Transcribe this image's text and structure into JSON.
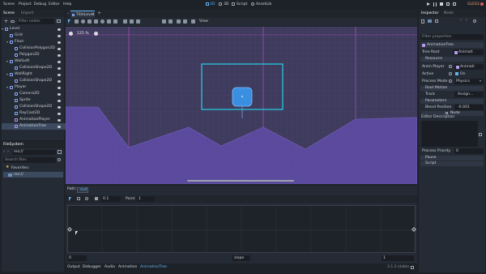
{
  "menu": [
    "Scene",
    "Project",
    "Debug",
    "Editor",
    "Help"
  ],
  "workspaces": [
    "2D",
    "3D",
    "Script",
    "AssetLib"
  ],
  "renderer": "GLES3",
  "left_tabs": [
    "Scene",
    "Import"
  ],
  "filter_nodes_placeholder": "Filter nodes",
  "scene_tree": [
    {
      "label": "Level",
      "depth": 0,
      "icon": "node2d-icon",
      "color": "#8fb0ff"
    },
    {
      "label": "Grid",
      "depth": 1,
      "icon": "tilemap-icon",
      "color": "#8fb0ff"
    },
    {
      "label": "Floor",
      "depth": 1,
      "icon": "staticbody-icon",
      "color": "#8fb0ff"
    },
    {
      "label": "CollisionPolygon2D",
      "depth": 2,
      "icon": "collision-icon",
      "color": "#8fb0ff"
    },
    {
      "label": "Polygon2D",
      "depth": 2,
      "icon": "polygon-icon",
      "color": "#8fb0ff"
    },
    {
      "label": "WallLeft",
      "depth": 1,
      "icon": "staticbody-icon",
      "color": "#8fb0ff"
    },
    {
      "label": "CollisionShape2D",
      "depth": 2,
      "icon": "collision-icon",
      "color": "#8fb0ff"
    },
    {
      "label": "WallRight",
      "depth": 1,
      "icon": "staticbody-icon",
      "color": "#8fb0ff"
    },
    {
      "label": "CollisionShape2D",
      "depth": 2,
      "icon": "collision-icon",
      "color": "#8fb0ff"
    },
    {
      "label": "Player",
      "depth": 1,
      "icon": "kinematic-icon",
      "color": "#8fb0ff"
    },
    {
      "label": "Camera2D",
      "depth": 2,
      "icon": "camera-icon",
      "color": "#8fb0ff"
    },
    {
      "label": "Sprite",
      "depth": 2,
      "icon": "sprite-icon",
      "color": "#8fb0ff"
    },
    {
      "label": "CollisionShape2D",
      "depth": 2,
      "icon": "collision-icon",
      "color": "#8fb0ff"
    },
    {
      "label": "RayCast2D",
      "depth": 2,
      "icon": "raycast-icon",
      "color": "#8fb0ff"
    },
    {
      "label": "AnimationPlayer",
      "depth": 2,
      "icon": "animplayer-icon",
      "color": "#b89cf0"
    },
    {
      "label": "AnimationTree",
      "depth": 2,
      "icon": "animtree-icon",
      "color": "#b89cf0",
      "selected": true
    }
  ],
  "filesystem": {
    "title": "FileSystem",
    "path": "res://",
    "search_placeholder": "Search files",
    "favorites": "Favorites:",
    "root": "res://"
  },
  "editor_tabs": [
    "TitleLevel"
  ],
  "viewport": {
    "zoom": "125 %",
    "view_label": "View"
  },
  "anim_panel": {
    "path_label": "Path:",
    "path_value": "root",
    "snap_value": "0.1",
    "point_label": "Point",
    "point_value": "1",
    "min_value": "0",
    "center_label": "slope",
    "max_value": "1"
  },
  "bottom_tabs": [
    "Output",
    "Debugger",
    "Audio",
    "Animation",
    "AnimationTree"
  ],
  "version": "3.1.2.stable",
  "right_tabs": [
    "Inspector",
    "Node"
  ],
  "inspector": {
    "filter_placeholder": "Filter properties",
    "object": "AnimationTree",
    "tree_root_label": "Tree Root",
    "tree_root_value": "Animati",
    "resource_section": "Resource",
    "anim_player_label": "Anim Player",
    "anim_player_value": "Animati",
    "active_label": "Active",
    "active_value": "On",
    "process_mode_label": "Process Mode",
    "process_mode_value": "Physics",
    "root_motion_section": "Root Motion",
    "track_label": "Track",
    "track_value": "Assign...",
    "parameters_section": "Parameters",
    "blend_position_label": "Blend Position",
    "blend_position_value": "-0.001",
    "node_button": "Node",
    "editor_description_label": "Editor Description",
    "process_priority_label": "Process Priority",
    "process_priority_value": "0",
    "pause_section": "Pause",
    "script_section": "Script"
  },
  "colors": {
    "accent": "#62b3f2",
    "purple_fill": "#5b4a9e",
    "grid_bg": "#3f3b5d",
    "camera_rect": "#27d0e8",
    "player": "#3a8fe0"
  }
}
